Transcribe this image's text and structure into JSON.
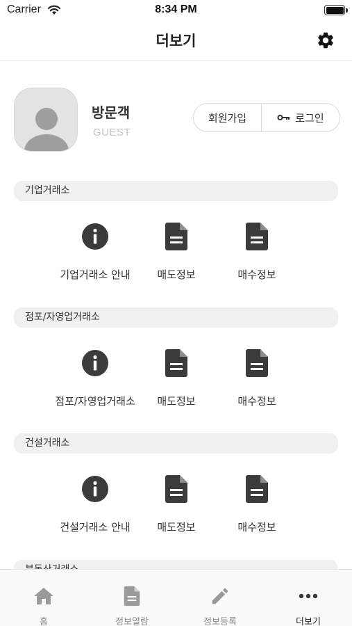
{
  "status_bar": {
    "carrier": "Carrier",
    "time": "8:34 PM"
  },
  "nav": {
    "title": "더보기",
    "settings_icon": "gear-icon"
  },
  "profile": {
    "name": "방문객",
    "subtitle": "GUEST",
    "signup_label": "회원가입",
    "login_label": "로그인",
    "login_icon": "key-icon"
  },
  "sections": [
    {
      "title": "기업거래소",
      "items": [
        {
          "label": "기업거래소 안내",
          "icon": "info-icon"
        },
        {
          "label": "매도정보",
          "icon": "document-icon"
        },
        {
          "label": "매수정보",
          "icon": "document-icon"
        }
      ]
    },
    {
      "title": "점포/자영업거래소",
      "items": [
        {
          "label": "점포/자영업거래소",
          "icon": "info-icon"
        },
        {
          "label": "매도정보",
          "icon": "document-icon"
        },
        {
          "label": "매수정보",
          "icon": "document-icon"
        }
      ]
    },
    {
      "title": "건설거래소",
      "items": [
        {
          "label": "건설거래소 안내",
          "icon": "info-icon"
        },
        {
          "label": "매도정보",
          "icon": "document-icon"
        },
        {
          "label": "매수정보",
          "icon": "document-icon"
        }
      ]
    },
    {
      "title": "부동산거래소"
    }
  ],
  "tabs": [
    {
      "label": "홈",
      "icon": "home-icon"
    },
    {
      "label": "정보열람",
      "icon": "document-icon"
    },
    {
      "label": "정보등록",
      "icon": "pencil-icon"
    },
    {
      "label": "더보기",
      "icon": "more-icon",
      "active": true
    }
  ],
  "colors": {
    "icon": "#3b3b3b",
    "tab_inactive": "#9a9a9a",
    "tab_active": "#3a3a3a",
    "section_bg": "#f0f0f0"
  }
}
